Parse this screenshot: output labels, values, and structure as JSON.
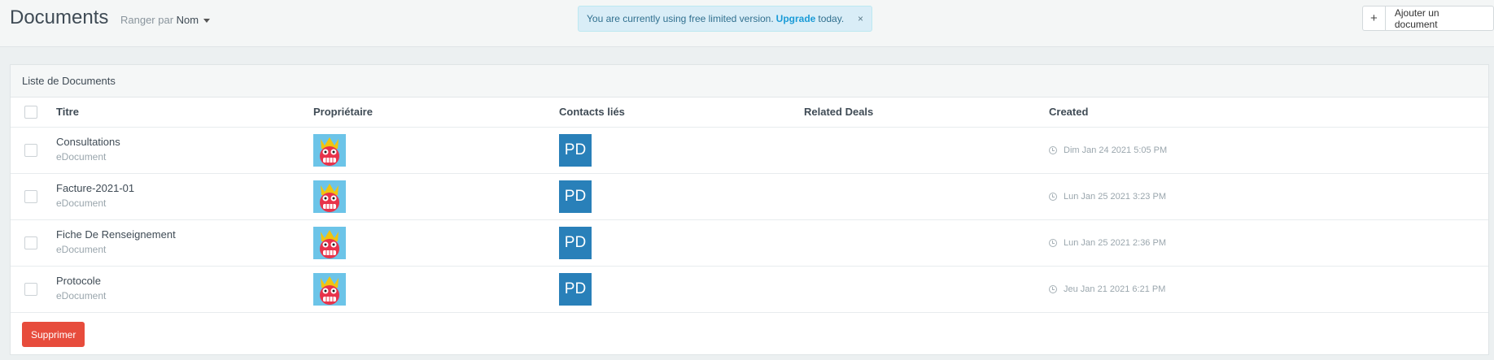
{
  "header": {
    "title": "Documents",
    "sort_label": "Ranger par",
    "sort_value": "Nom"
  },
  "alert": {
    "text_before": "You are currently using free limited version.",
    "link": "Upgrade",
    "text_after": "today.",
    "close": "×"
  },
  "actions": {
    "plus": "+",
    "add_label": "Ajouter un document"
  },
  "panel": {
    "title": "Liste de Documents",
    "columns": {
      "title": "Titre",
      "owner": "Propriétaire",
      "contacts": "Contacts liés",
      "deals": "Related Deals",
      "created": "Created"
    },
    "rows": [
      {
        "title": "Consultations",
        "type": "eDocument",
        "contact": "PD",
        "created": "Dim Jan 24 2021 5:05 PM"
      },
      {
        "title": "Facture-2021-01",
        "type": "eDocument",
        "contact": "PD",
        "created": "Lun Jan 25 2021 3:23 PM"
      },
      {
        "title": "Fiche De Renseignement",
        "type": "eDocument",
        "contact": "PD",
        "created": "Lun Jan 25 2021 2:36 PM"
      },
      {
        "title": "Protocole",
        "type": "eDocument",
        "contact": "PD",
        "created": "Jeu Jan 21 2021 6:21 PM"
      }
    ],
    "delete_label": "Supprimer"
  },
  "colors": {
    "accent": "#1a9bd7",
    "danger": "#e74c3c",
    "contact_badge": "#2980b9",
    "avatar_bg": "#6cc4e8"
  }
}
